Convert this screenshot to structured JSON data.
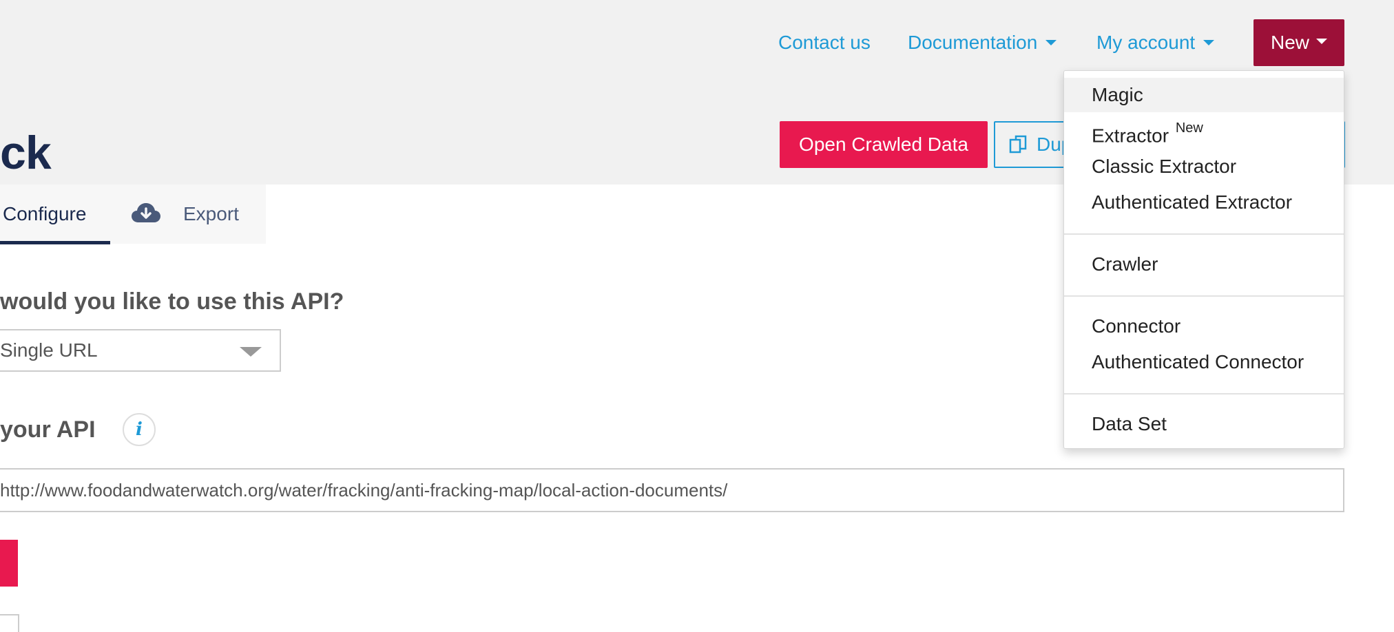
{
  "topnav": {
    "contact": "Contact us",
    "documentation": "Documentation",
    "account": "My account",
    "new_button": "New"
  },
  "page": {
    "title": "ck"
  },
  "actions": {
    "open_crawled": "Open Crawled Data",
    "duplicate": "Duplicate"
  },
  "tabs": {
    "configure": "Configure",
    "export": "Export"
  },
  "form": {
    "question": "would you like to use this API?",
    "select_value": "Single URL",
    "api_label": "your API",
    "info_glyph": "i",
    "url_value": "http://www.foodandwaterwatch.org/water/fracking/anti-fracking-map/local-action-documents/"
  },
  "new_menu": {
    "items": [
      {
        "label": "Magic"
      },
      {
        "label": "Extractor",
        "badge": "New"
      },
      {
        "label": "Classic Extractor"
      },
      {
        "label": "Authenticated Extractor"
      },
      {
        "label": "Crawler"
      },
      {
        "label": "Connector"
      },
      {
        "label": "Authenticated Connector"
      },
      {
        "label": "Data Set"
      }
    ]
  },
  "colors": {
    "accent_blue": "#1e9ad6",
    "new_button": "#9c1038",
    "primary_pink": "#e8194f",
    "navy": "#1b2a4e"
  },
  "icons": {
    "export": "cloud-download-icon",
    "duplicate": "copy-icon",
    "info": "info-icon"
  }
}
